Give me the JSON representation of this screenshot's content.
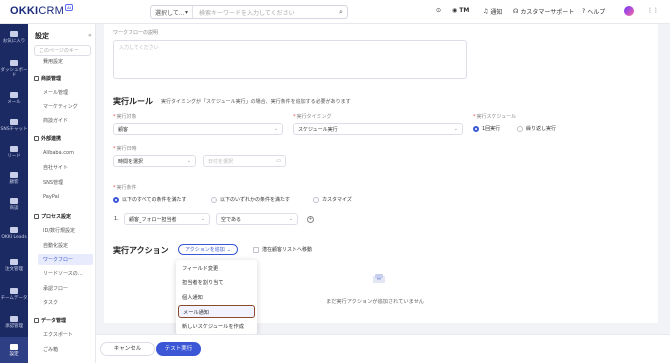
{
  "app": {
    "logo_text": "OKKI",
    "logo_sub": "CRM",
    "logo_badge": "AI"
  },
  "search": {
    "scope": "選択して...",
    "placeholder": "検索キーワードを入力してください"
  },
  "topbar": {
    "tm": "TM",
    "notify": "通知",
    "support": "カスタマーサポート",
    "help": "ヘルプ"
  },
  "sidebar": [
    {
      "label": "お気に入り",
      "icon": "star-icon"
    },
    {
      "label": "ダッシュボード",
      "icon": "dashboard-icon"
    },
    {
      "label": "メール",
      "icon": "mail-icon"
    },
    {
      "label": "SNSチャット",
      "icon": "chat-icon"
    },
    {
      "label": "リード",
      "icon": "lead-icon"
    },
    {
      "label": "顧客",
      "icon": "customer-icon"
    },
    {
      "label": "商談",
      "icon": "deal-icon"
    },
    {
      "label": "OKKI Leads",
      "icon": "leads-icon"
    },
    {
      "label": "注文管理",
      "icon": "order-icon"
    },
    {
      "label": "チームデータ",
      "icon": "team-data-icon"
    },
    {
      "label": "承認管理",
      "icon": "approval-icon"
    },
    {
      "label": "設定",
      "icon": "settings-icon"
    }
  ],
  "nav2": {
    "title": "設定",
    "search_placeholder": "このページのキー",
    "top_link": "費用設定",
    "groups": [
      {
        "label": "商談管理",
        "links": [
          "メール管理",
          "マーケティング",
          "商談ガイド"
        ]
      },
      {
        "label": "外部連携",
        "links": [
          "Alibaba.com",
          "自社サイト",
          "SNS管理",
          "PayPal"
        ]
      },
      {
        "label": "プロセス設定",
        "links": [
          "ID/数行規設定",
          "自動化設定",
          "ワークフロー",
          "リードソースの…",
          "承認フロー",
          "タスク"
        ]
      },
      {
        "label": "データ管理",
        "links": [
          "エクスポート",
          "ごみ箱"
        ]
      }
    ]
  },
  "form": {
    "desc_label": "ワークフローの説明",
    "desc_placeholder": "入力してください",
    "exec_rule_title": "実行ルール",
    "exec_rule_note": "実行タイミングが「スケジュール実行」の場合、実行条件を追加する必要があります",
    "target_label": "実行対象",
    "target_value": "顧客",
    "timing_label": "実行タイミング",
    "timing_value": "スケジュール実行",
    "schedule_label": "実行スケジュール",
    "schedule_once": "1回実行",
    "schedule_repeat": "繰り返し実行",
    "date_label": "実行日時",
    "time_select": "時間を選択",
    "date_select": "日付を選択",
    "cond_label": "実行条件",
    "cond_all": "以下のすべての条件を満たす",
    "cond_any": "以下のいずれかの条件を満たす",
    "cond_custom": "カスタマイズ",
    "cond_index": "1.",
    "cond_field": "顧客_フォロー担当者",
    "cond_op": "空である",
    "action_title": "実行アクション",
    "action_add": "アクションを追加",
    "move_pool": "潜在顧客リストへ移動",
    "empty_text": "まだ実行アクションが追加されていません"
  },
  "menu": [
    "フィールド変更",
    "担当者を割り当て",
    "個人通知",
    "メール通知",
    "新しいスケジュールを作成"
  ],
  "bottom": {
    "cancel": "キャンセル",
    "test": "テスト実行"
  },
  "colors": {
    "accent": "#3b57d6",
    "sidebar": "#1b2a63",
    "highlight_border": "#8a4b2a"
  }
}
